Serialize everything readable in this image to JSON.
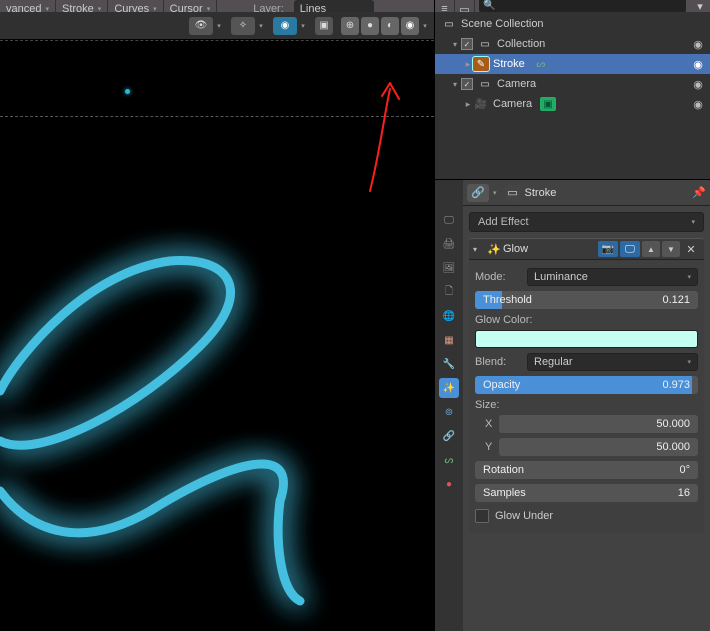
{
  "header": {
    "left_items": [
      {
        "label": "vanced"
      },
      {
        "label": "Stroke"
      },
      {
        "label": "Curves"
      },
      {
        "label": "Cursor"
      }
    ],
    "layer_label": "Layer:",
    "layer_value": "Lines"
  },
  "viewport_overlays": {
    "shading_modes": [
      "wire",
      "solid",
      "matcap",
      "material",
      "rendered"
    ]
  },
  "outliner": {
    "scene": "Scene Collection",
    "items": [
      {
        "name": "Collection",
        "type": "collection",
        "depth": 1,
        "expanded": true,
        "checked": true
      },
      {
        "name": "Stroke",
        "type": "gpencil",
        "depth": 2,
        "expanded": true,
        "checked": true,
        "selected": true
      },
      {
        "name": "Camera",
        "type": "object",
        "depth": 2,
        "expanded": true,
        "checked": true
      },
      {
        "name": "Camera",
        "type": "camera-data",
        "depth": 3,
        "expanded": false
      }
    ]
  },
  "properties": {
    "breadcrumb_item": "Stroke",
    "add_effect_label": "Add Effect",
    "effect": {
      "name": "Glow",
      "mode_label": "Mode:",
      "mode_value": "Luminance",
      "threshold_label": "Threshold",
      "threshold_value": "0.121",
      "threshold_fill_pct": 12.1,
      "glow_color_label": "Glow Color:",
      "glow_color_hex": "#c4fff4",
      "blend_label": "Blend:",
      "blend_value": "Regular",
      "opacity_label": "Opacity",
      "opacity_value": "0.973",
      "opacity_fill_pct": 97.3,
      "size_label": "Size:",
      "size_x_label": "X",
      "size_x_value": "50.000",
      "size_y_label": "Y",
      "size_y_value": "50.000",
      "rotation_label": "Rotation",
      "rotation_value": "0°",
      "samples_label": "Samples",
      "samples_value": "16",
      "glow_under_label": "Glow Under"
    }
  }
}
